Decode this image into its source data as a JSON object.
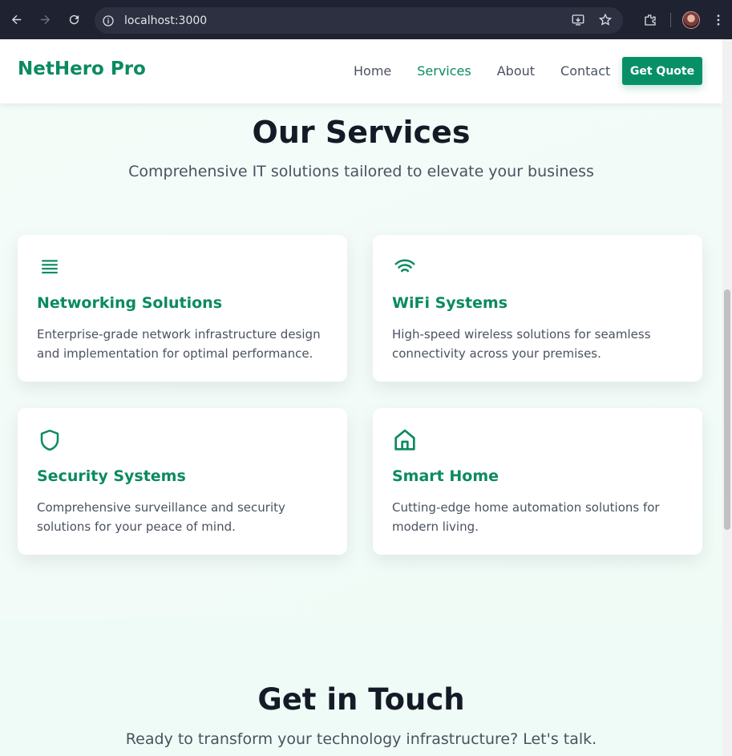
{
  "browser": {
    "url": "localhost:3000"
  },
  "header": {
    "logo": "NetHero Pro",
    "nav": [
      "Home",
      "Services",
      "About",
      "Contact"
    ],
    "active_nav": "Services",
    "cta_label": "Get Quote"
  },
  "services": {
    "title": "Our Services",
    "subtitle": "Comprehensive IT solutions tailored to elevate your business",
    "cards": [
      {
        "icon": "list-icon",
        "title": "Networking Solutions",
        "description": "Enterprise-grade network infrastructure design and implementation for optimal performance."
      },
      {
        "icon": "wifi-icon",
        "title": "WiFi Systems",
        "description": "High-speed wireless solutions for seamless connectivity across your premises."
      },
      {
        "icon": "shield-icon",
        "title": "Security Systems",
        "description": "Comprehensive surveillance and security solutions for your peace of mind."
      },
      {
        "icon": "home-icon",
        "title": "Smart Home",
        "description": "Cutting-edge home automation solutions for modern living."
      }
    ]
  },
  "contact": {
    "title": "Get in Touch",
    "subtitle": "Ready to transform your technology infrastructure? Let's talk."
  },
  "colors": {
    "accent": "#0b8a62",
    "button": "#079068",
    "heading": "#141a26",
    "body_text": "#4a5260"
  }
}
